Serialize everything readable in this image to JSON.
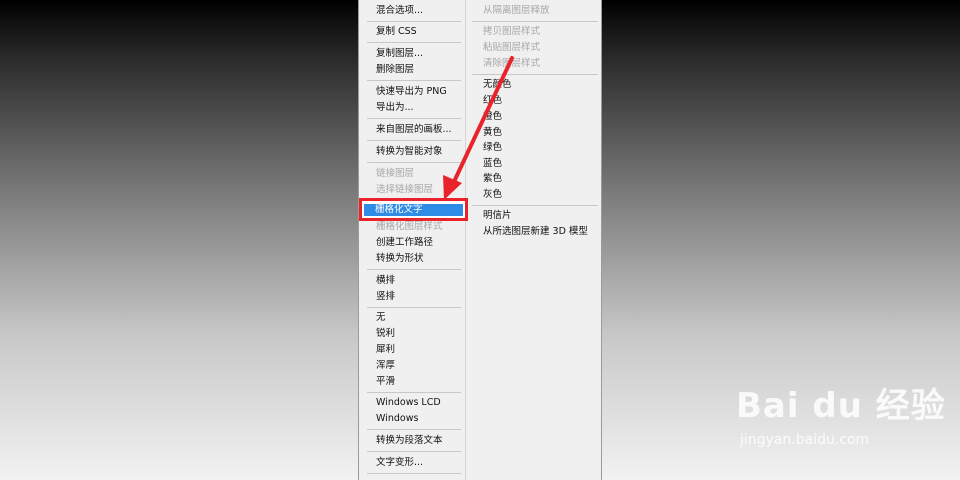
{
  "menu": {
    "left": {
      "blend_options": "混合选项...",
      "copy_css": "复制 CSS",
      "duplicate_layer": "复制图层...",
      "delete_layer": "删除图层",
      "quick_export_png": "快速导出为 PNG",
      "export_as": "导出为...",
      "artboard_from_layers": "来自图层的画板...",
      "convert_smart_object": "转换为智能对象",
      "link_layers": "链接图层",
      "select_linked_layers": "选择链接图层",
      "rasterize_type": "栅格化文字",
      "rasterize_layer_style": "栅格化图层样式",
      "create_work_path": "创建工作路径",
      "convert_to_shape": "转换为形状",
      "horizontal": "横排",
      "vertical": "竖排",
      "aa_none": "无",
      "aa_sharp": "锐利",
      "aa_crisp": "犀利",
      "aa_strong": "浑厚",
      "aa_smooth": "平滑",
      "windows_lcd": "Windows LCD",
      "windows": "Windows",
      "convert_paragraph_text": "转换为段落文本",
      "warp_text": "文字变形..."
    },
    "right": {
      "release_isolation": "从隔离图层释放",
      "copy_layer_style": "拷贝图层样式",
      "paste_layer_style": "粘贴图层样式",
      "clear_layer_style": "清除图层样式",
      "no_color": "无颜色",
      "red": "红色",
      "orange": "橙色",
      "yellow": "黄色",
      "green": "绿色",
      "blue": "蓝色",
      "violet": "紫色",
      "gray": "灰色",
      "postcard": "明信片",
      "new_3d_from_selected": "从所选图层新建 3D 模型"
    }
  },
  "watermark": {
    "logo_text": "Bai du 经验",
    "url": "jingyan.baidu.com"
  },
  "colors": {
    "highlight_bar": "#2f8ce6",
    "annotation_red": "#e8232a"
  }
}
